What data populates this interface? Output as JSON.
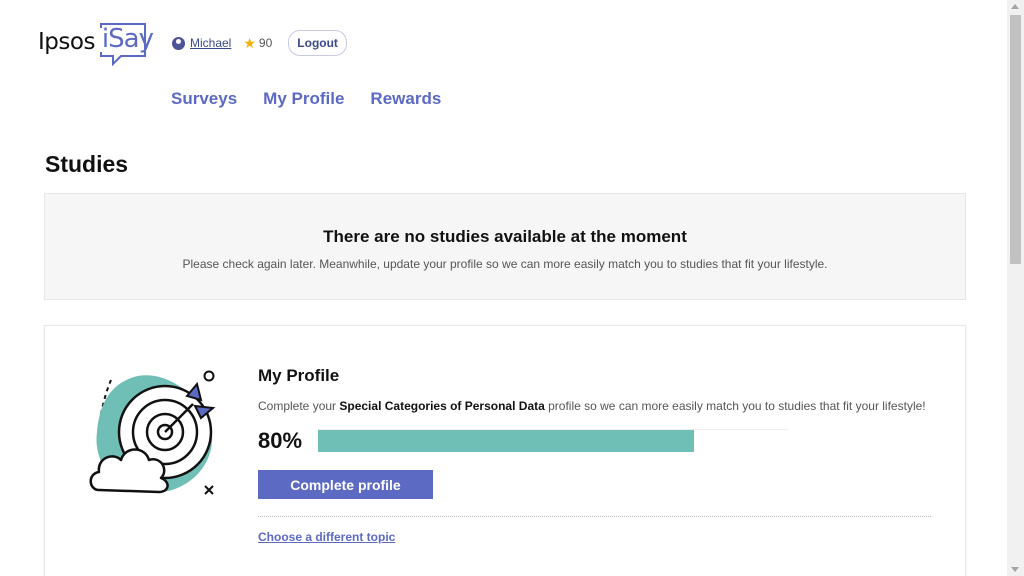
{
  "brand": {
    "name_left": "Ipsos",
    "name_right": "iSay",
    "accent_color": "#5c6ac4"
  },
  "user": {
    "icon": "user-circle-icon",
    "name": "Michael",
    "points_icon": "star-icon",
    "points": "90",
    "logout_label": "Logout"
  },
  "nav": {
    "items": [
      {
        "label": "Surveys"
      },
      {
        "label": "My Profile"
      },
      {
        "label": "Rewards"
      }
    ]
  },
  "page": {
    "title": "Studies"
  },
  "notice": {
    "title": "There are no studies available at the moment",
    "text": "Please check again later. Meanwhile, update your profile so we can more easily match you to studies that fit your lifestyle."
  },
  "profile_card": {
    "illustration": "target-arrow-illustration",
    "title": "My Profile",
    "desc_prefix": "Complete your ",
    "desc_highlight": "Special Categories of Personal Data",
    "desc_suffix": " profile so we can more easily match you to studies that fit your lifestyle!",
    "progress_label": "80%",
    "progress_fraction": 0.8,
    "progress_color": "#6fbfb6",
    "button_label": "Complete profile",
    "alt_link_label": "Choose a different topic"
  }
}
